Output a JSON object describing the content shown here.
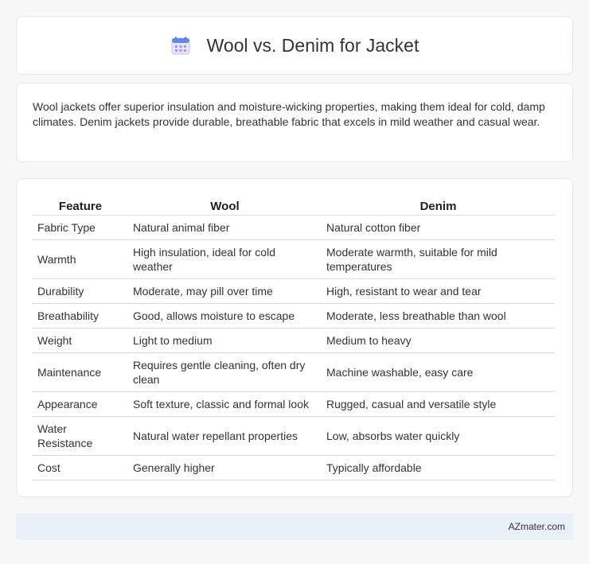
{
  "header": {
    "title": "Wool vs. Denim for Jacket",
    "icon": "calendar-icon"
  },
  "intro": {
    "text": "Wool jackets offer superior insulation and moisture-wicking properties, making them ideal for cold, damp climates. Denim jackets provide durable, breathable fabric that excels in mild weather and casual wear."
  },
  "table": {
    "headers": [
      "Feature",
      "Wool",
      "Denim"
    ],
    "rows": [
      [
        "Fabric Type",
        "Natural animal fiber",
        "Natural cotton fiber"
      ],
      [
        "Warmth",
        "High insulation, ideal for cold weather",
        "Moderate warmth, suitable for mild temperatures"
      ],
      [
        "Durability",
        "Moderate, may pill over time",
        "High, resistant to wear and tear"
      ],
      [
        "Breathability",
        "Good, allows moisture to escape",
        "Moderate, less breathable than wool"
      ],
      [
        "Weight",
        "Light to medium",
        "Medium to heavy"
      ],
      [
        "Maintenance",
        "Requires gentle cleaning, often dry clean",
        "Machine washable, easy care"
      ],
      [
        "Appearance",
        "Soft texture, classic and formal look",
        "Rugged, casual and versatile style"
      ],
      [
        "Water Resistance",
        "Natural water repellant properties",
        "Low, absorbs water quickly"
      ],
      [
        "Cost",
        "Generally higher",
        "Typically affordable"
      ]
    ]
  },
  "footer": {
    "text": "AZmater.com"
  }
}
